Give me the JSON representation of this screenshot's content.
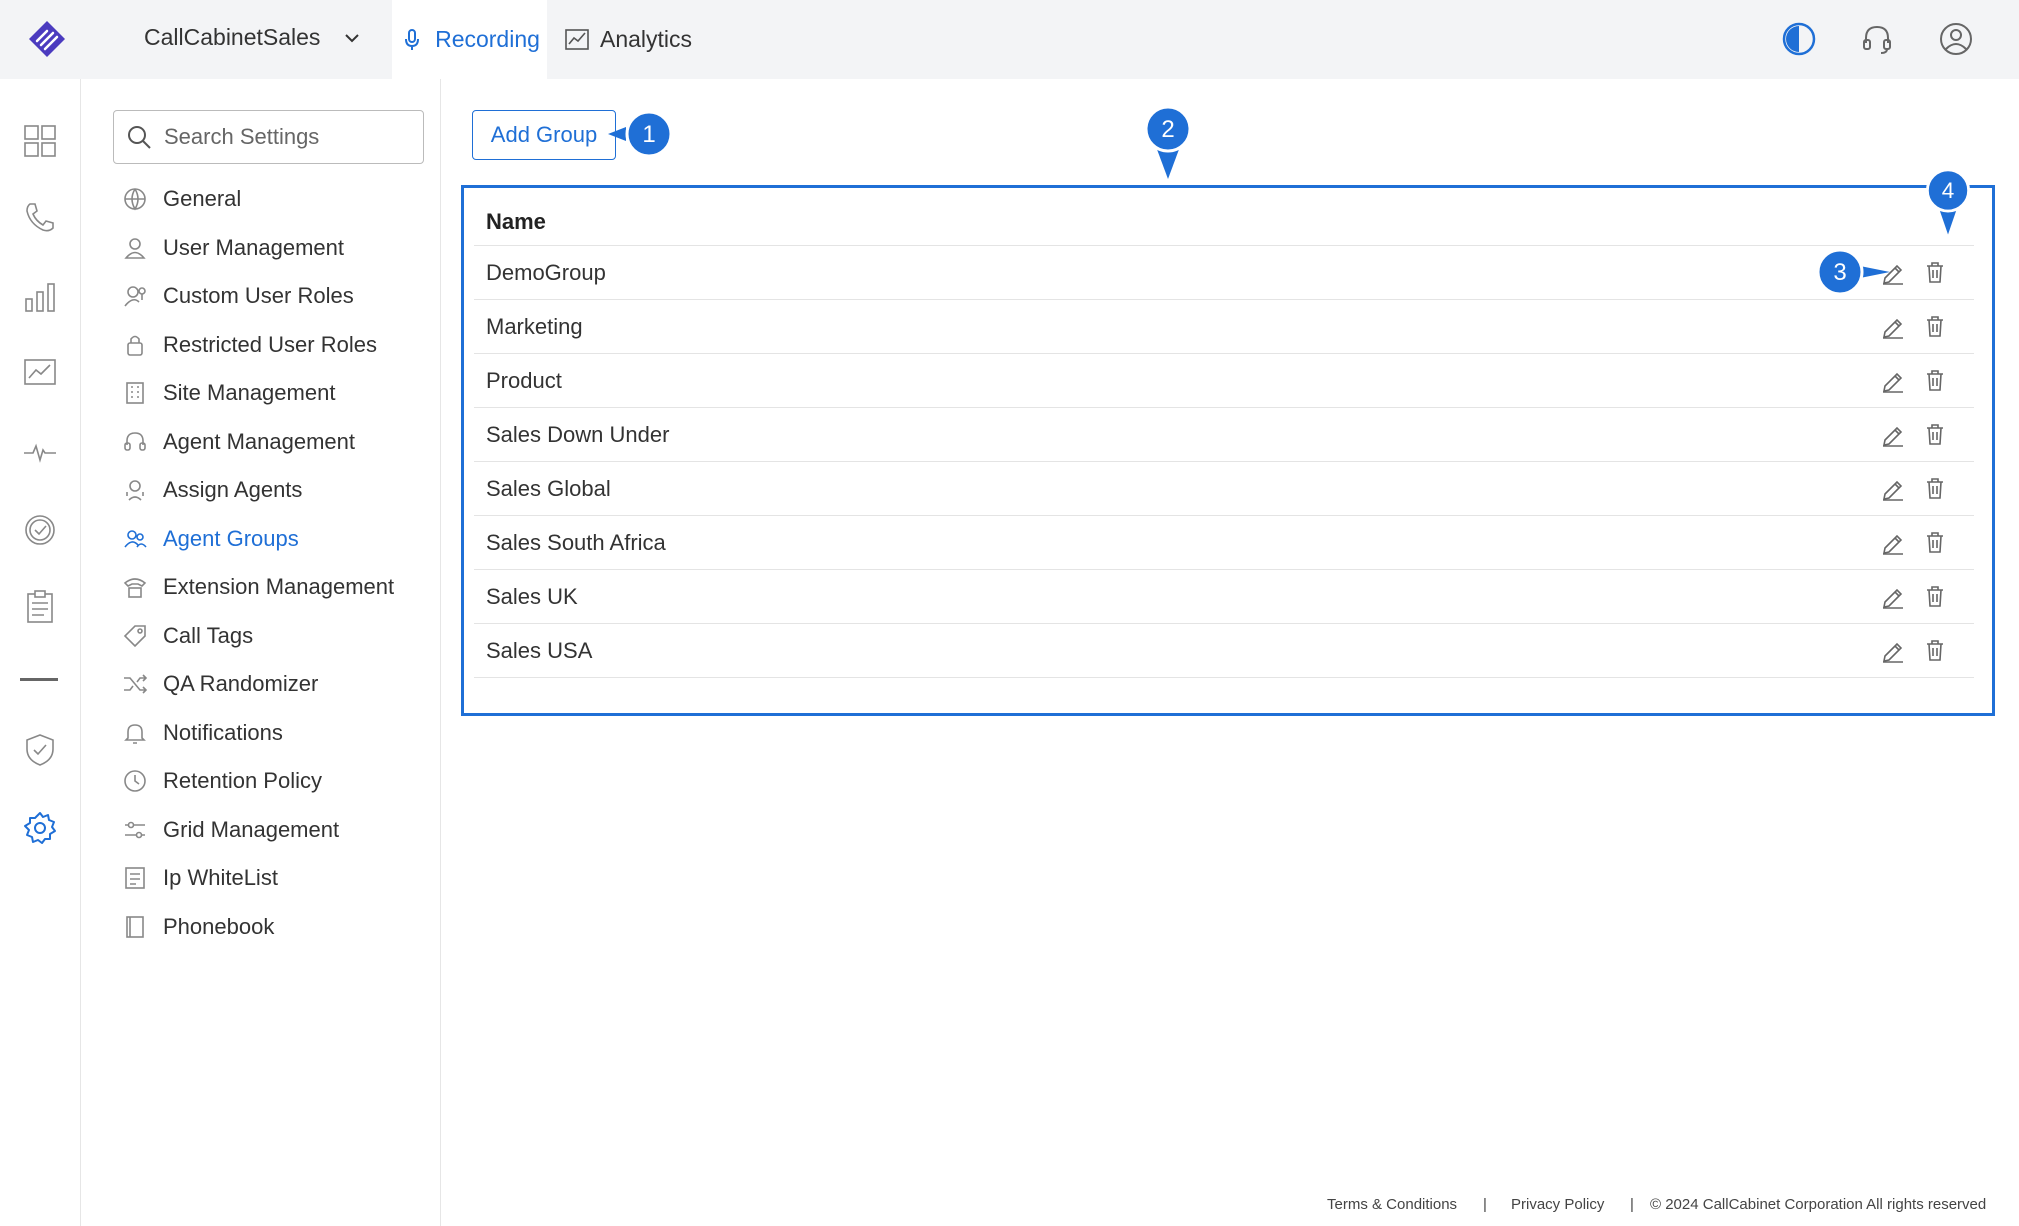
{
  "colors": {
    "accent": "#1f6fd6",
    "topbar_bg": "#f3f4f6",
    "callout": "#1f6fd6"
  },
  "topbar": {
    "tenant": "CallCabinetSales",
    "tabs": [
      {
        "label": "Recording",
        "icon": "microphone-icon"
      },
      {
        "label": "Analytics",
        "icon": "chart-icon"
      }
    ],
    "right_icons": [
      "contrast-icon",
      "headset-icon",
      "user-icon"
    ]
  },
  "rail_icons": [
    "dashboard-icon",
    "phone-icon",
    "bar-chart-icon",
    "analytics-icon",
    "pulse-icon",
    "check-circle-icon",
    "clipboard-icon",
    "shield-icon",
    "settings-icon"
  ],
  "sidebar": {
    "search_placeholder": "Search Settings",
    "items": [
      {
        "label": "General",
        "icon": "globe-icon"
      },
      {
        "label": "User Management",
        "icon": "user-icon"
      },
      {
        "label": "Custom User Roles",
        "icon": "user-key-icon"
      },
      {
        "label": "Restricted User Roles",
        "icon": "lock-icon"
      },
      {
        "label": "Site Management",
        "icon": "building-icon"
      },
      {
        "label": "Agent Management",
        "icon": "headset-icon"
      },
      {
        "label": "Assign Agents",
        "icon": "assign-agent-icon"
      },
      {
        "label": "Agent Groups",
        "icon": "group-icon",
        "active": true
      },
      {
        "label": "Extension Management",
        "icon": "telephone-icon"
      },
      {
        "label": "Call Tags",
        "icon": "tag-icon"
      },
      {
        "label": "QA Randomizer",
        "icon": "shuffle-icon"
      },
      {
        "label": "Notifications",
        "icon": "bell-icon"
      },
      {
        "label": "Retention Policy",
        "icon": "clock-icon"
      },
      {
        "label": "Grid Management",
        "icon": "sliders-icon"
      },
      {
        "label": "Ip WhiteList",
        "icon": "list-icon"
      },
      {
        "label": "Phonebook",
        "icon": "book-icon"
      }
    ]
  },
  "main": {
    "add_button": "Add Group",
    "table": {
      "header": "Name",
      "rows": [
        "DemoGroup",
        "Marketing",
        "Product",
        "Sales Down Under",
        "Sales Global",
        "Sales South Africa",
        "Sales UK",
        "Sales USA"
      ]
    },
    "callouts": [
      "1",
      "2",
      "3",
      "4"
    ]
  },
  "footer": {
    "terms": "Terms & Conditions",
    "privacy": "Privacy Policy",
    "sep": "|",
    "copyright": "© 2024 CallCabinet Corporation All rights reserved"
  }
}
